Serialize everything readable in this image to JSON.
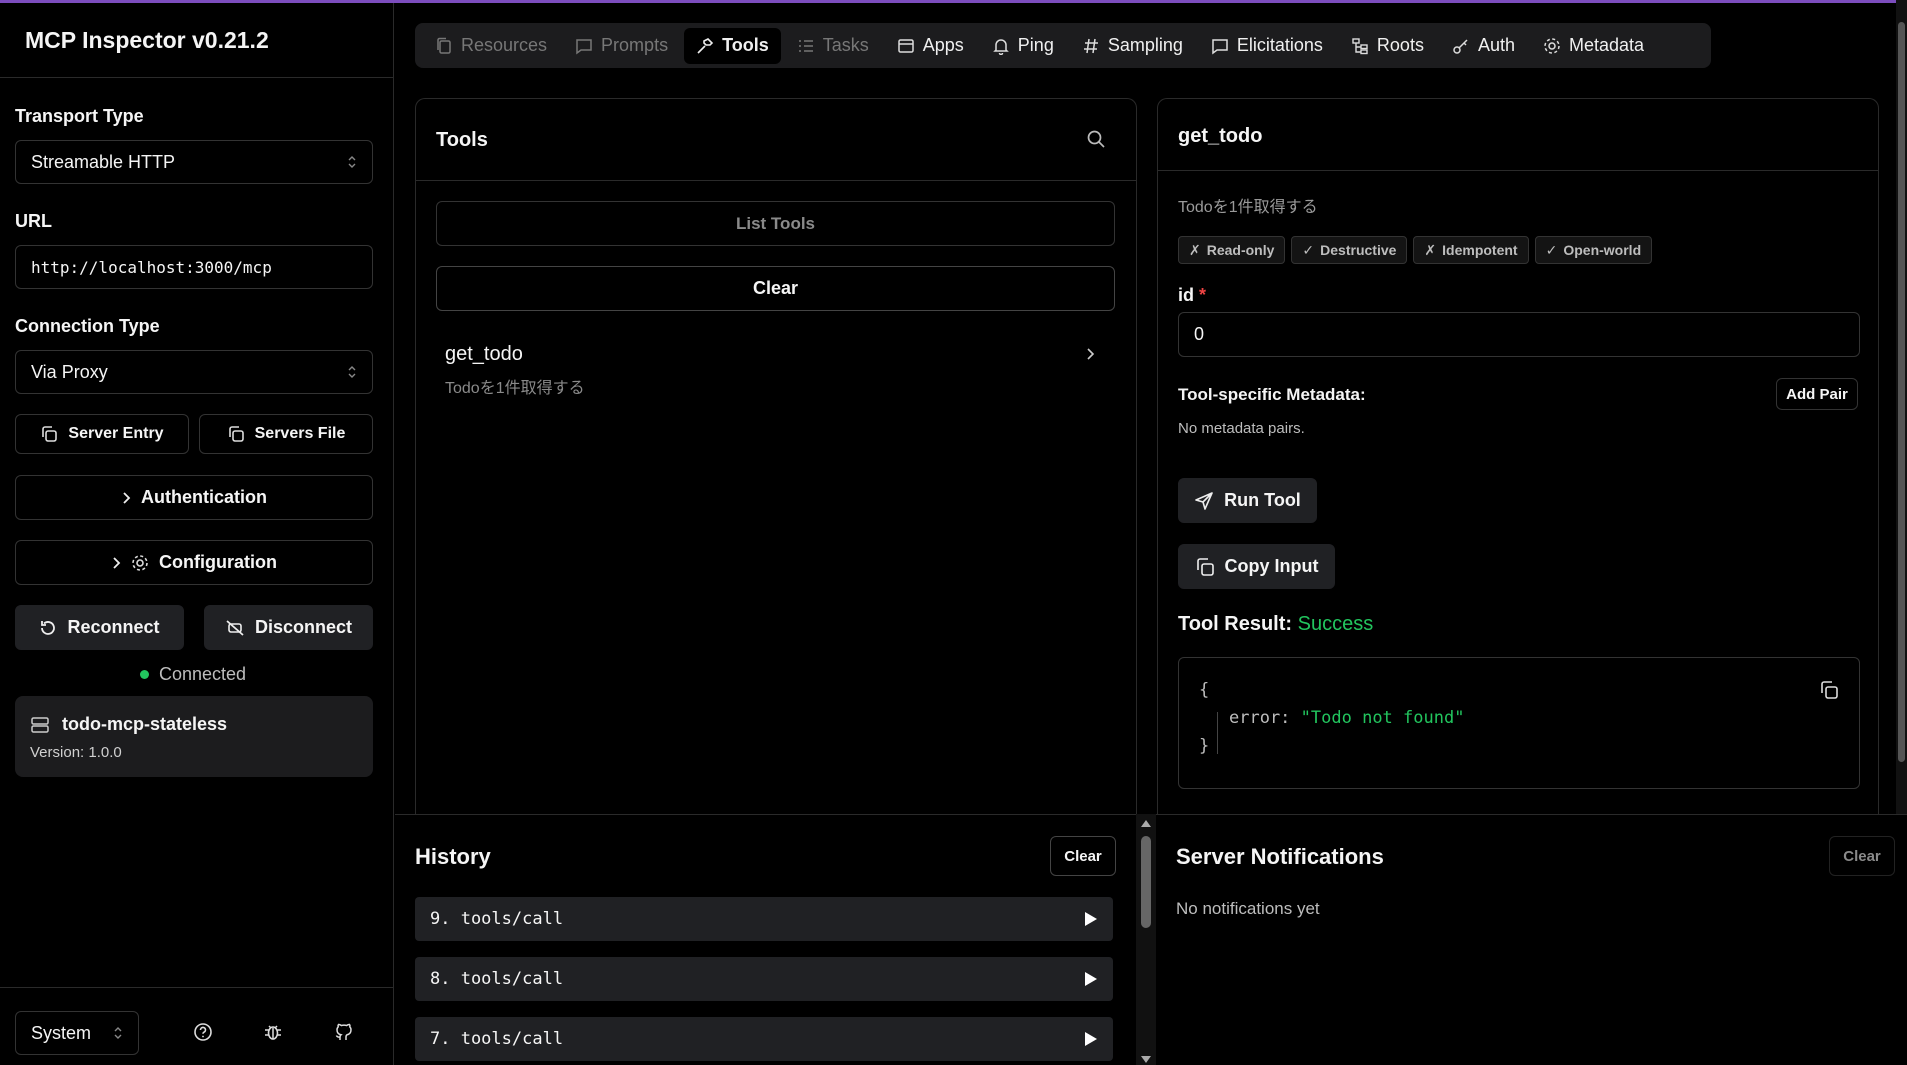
{
  "app": {
    "title": "MCP Inspector v0.21.2"
  },
  "sidebar": {
    "transport_label": "Transport Type",
    "transport_value": "Streamable HTTP",
    "url_label": "URL",
    "url_value": "http://localhost:3000/mcp",
    "connection_label": "Connection Type",
    "connection_value": "Via Proxy",
    "server_entry": "Server Entry",
    "servers_file": "Servers File",
    "authentication": "Authentication",
    "configuration": "Configuration",
    "reconnect": "Reconnect",
    "disconnect": "Disconnect",
    "status": "Connected",
    "server_name": "todo-mcp-stateless",
    "server_version": "Version: 1.0.0",
    "theme": "System"
  },
  "tabs": [
    {
      "label": "Resources",
      "icon": "files-icon",
      "state": "disabled"
    },
    {
      "label": "Prompts",
      "icon": "message-icon",
      "state": "disabled"
    },
    {
      "label": "Tools",
      "icon": "hammer-icon",
      "state": "active"
    },
    {
      "label": "Tasks",
      "icon": "list-icon",
      "state": "disabled"
    },
    {
      "label": "Apps",
      "icon": "window-icon",
      "state": "normal"
    },
    {
      "label": "Ping",
      "icon": "bell-icon",
      "state": "normal"
    },
    {
      "label": "Sampling",
      "icon": "hash-icon",
      "state": "normal"
    },
    {
      "label": "Elicitations",
      "icon": "message-icon",
      "state": "normal"
    },
    {
      "label": "Roots",
      "icon": "folder-tree-icon",
      "state": "normal"
    },
    {
      "label": "Auth",
      "icon": "key-icon",
      "state": "normal"
    },
    {
      "label": "Metadata",
      "icon": "gear-icon",
      "state": "normal"
    }
  ],
  "tools_panel": {
    "title": "Tools",
    "list_button": "List Tools",
    "clear_button": "Clear",
    "items": [
      {
        "name": "get_todo",
        "description": "Todoを1件取得する"
      }
    ]
  },
  "detail": {
    "title": "get_todo",
    "description": "Todoを1件取得する",
    "badges": [
      {
        "mark": "✗",
        "label": "Read-only"
      },
      {
        "mark": "✓",
        "label": "Destructive"
      },
      {
        "mark": "✗",
        "label": "Idempotent"
      },
      {
        "mark": "✓",
        "label": "Open-world"
      }
    ],
    "param_name": "id",
    "param_required": "*",
    "param_value": "0",
    "metadata_label": "Tool-specific Metadata:",
    "add_pair": "Add Pair",
    "no_metadata": "No metadata pairs.",
    "run_tool": "Run Tool",
    "copy_input": "Copy Input",
    "result_label": "Tool Result:",
    "result_status": "Success",
    "result_open": "{",
    "result_key": "error:",
    "result_value": "\"Todo not found\"",
    "result_close": "}"
  },
  "history": {
    "title": "History",
    "clear": "Clear",
    "items": [
      "9. tools/call",
      "8. tools/call",
      "7. tools/call"
    ]
  },
  "notifications": {
    "title": "Server Notifications",
    "clear": "Clear",
    "empty": "No notifications yet"
  },
  "colors": {
    "success": "#22c55e",
    "required": "#ef4444",
    "accent_line": "#7c4dbd"
  }
}
